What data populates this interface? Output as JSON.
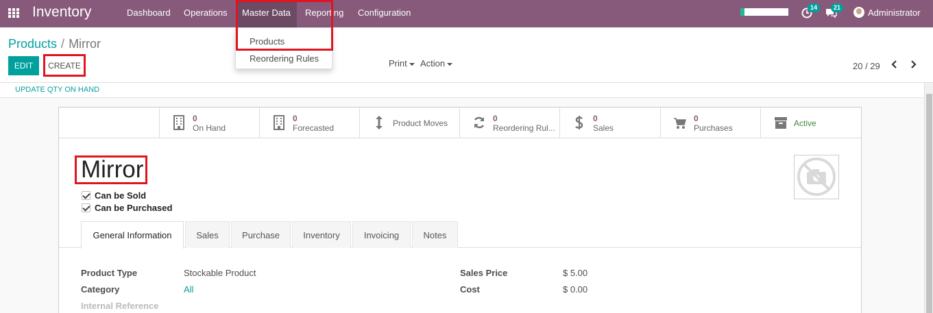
{
  "navbar": {
    "brand": "Inventory",
    "menu": [
      "Dashboard",
      "Operations",
      "Master Data",
      "Reporting",
      "Configuration"
    ],
    "progress": 0.08,
    "activity_count": "14",
    "message_count": "21",
    "user": "Administrator",
    "icons": {
      "apps": "apps-grid-icon",
      "activity": "clock-icon",
      "messages": "chat-icon"
    }
  },
  "dropdown": {
    "items": [
      "Products",
      "Reordering Rules"
    ]
  },
  "breadcrumb": {
    "parent": "Products",
    "separator": "/",
    "current": "Mirror"
  },
  "toolbar": {
    "edit_label": "EDIT",
    "create_label": "CREATE",
    "print_label": "Print",
    "action_label": "Action"
  },
  "pager": {
    "value": "20 / 29"
  },
  "statusbar": {
    "update_label": "UPDATE QTY ON HAND"
  },
  "stat_buttons": [
    {
      "value": "0",
      "label": "On Hand",
      "icon": "building-icon"
    },
    {
      "value": "0",
      "label": "Forecasted",
      "icon": "building-icon"
    },
    {
      "value": "",
      "label": "Product Moves",
      "icon": "up-down-arrow-icon"
    },
    {
      "value": "0",
      "label": "Reordering Rul...",
      "icon": "refresh-icon"
    },
    {
      "value": "0",
      "label": "Sales",
      "icon": "dollar-icon"
    },
    {
      "value": "0",
      "label": "Purchases",
      "icon": "cart-icon"
    },
    {
      "value": "",
      "label": "Active",
      "icon": "archive-icon"
    }
  ],
  "product": {
    "name": "Mirror",
    "can_be_sold_label": "Can be Sold",
    "can_be_purchased_label": "Can be Purchased"
  },
  "tabs": [
    "General Information",
    "Sales",
    "Purchase",
    "Inventory",
    "Invoicing",
    "Notes"
  ],
  "fields": {
    "product_type_label": "Product Type",
    "product_type_value": "Stockable Product",
    "category_label": "Category",
    "category_value": "All",
    "internal_ref_label": "Internal Reference",
    "sales_price_label": "Sales Price",
    "sales_price_value": "$ 5.00",
    "cost_label": "Cost",
    "cost_value": "$ 0.00"
  },
  "colors": {
    "navbar": "#875a7b",
    "primary": "#00a09d",
    "highlight": "#e0141f"
  }
}
